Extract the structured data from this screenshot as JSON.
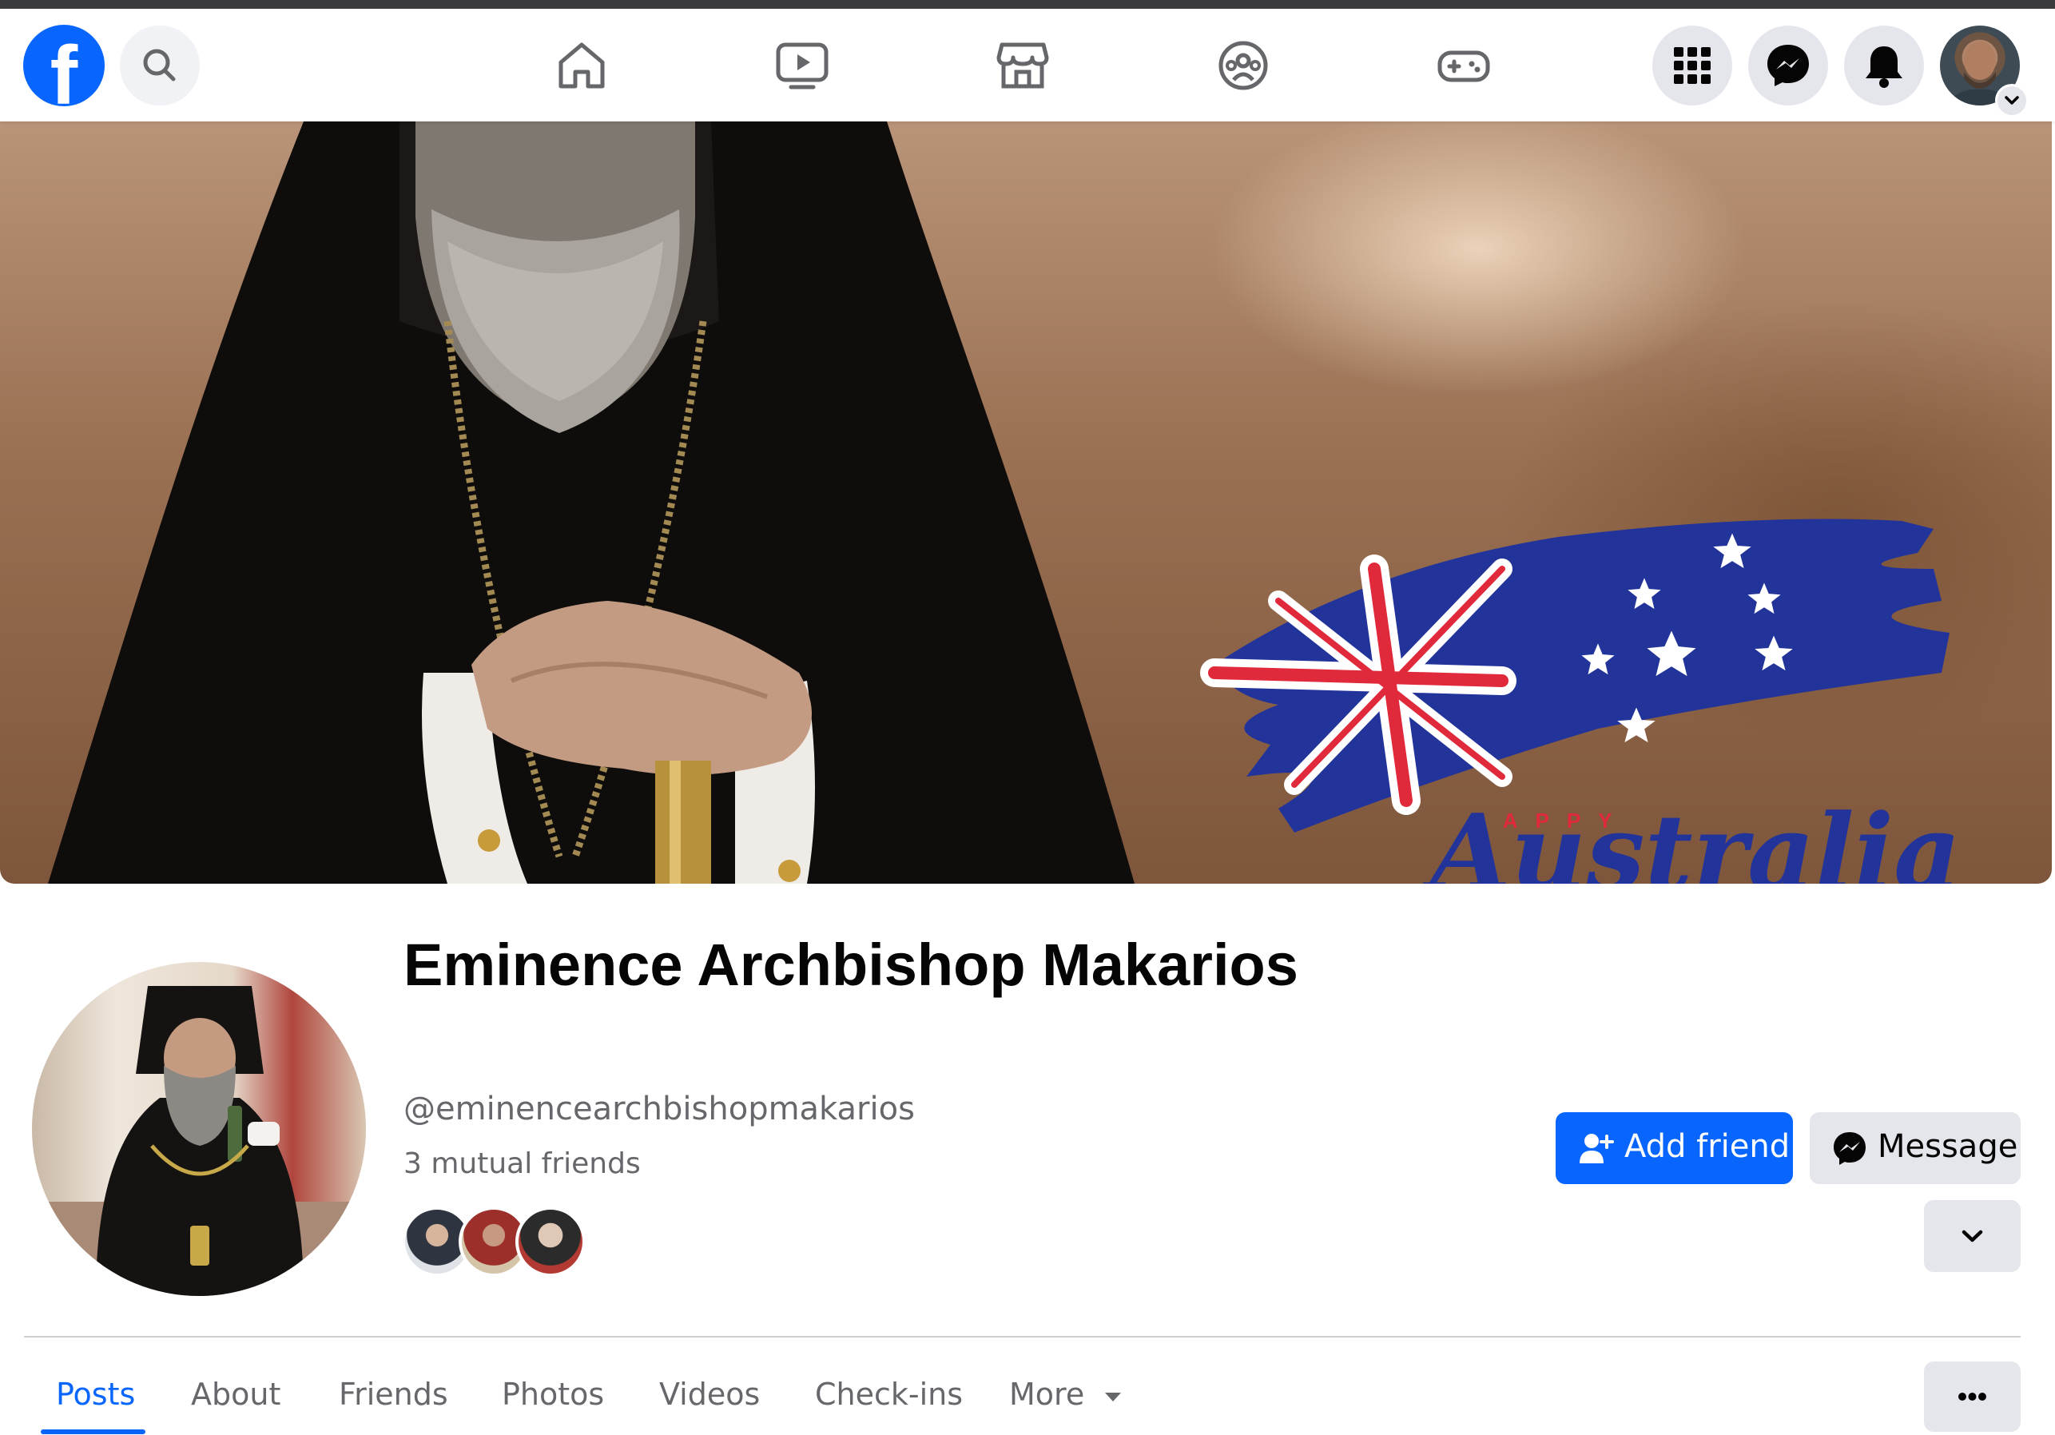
{
  "header": {
    "logo_letter": "f",
    "nav": [
      "home",
      "watch",
      "marketplace",
      "groups",
      "gaming"
    ]
  },
  "profile": {
    "name": "Eminence Archbishop Makarios",
    "handle": "@eminencearchbishopmakarios",
    "mutual_friends": "3 mutual friends",
    "cover_caption_small": "HAPPY",
    "cover_caption_large": "Australia"
  },
  "actions": {
    "add_friend": "Add friend",
    "message": "Message"
  },
  "tabs": [
    {
      "label": "Posts",
      "active": true
    },
    {
      "label": "About",
      "active": false
    },
    {
      "label": "Friends",
      "active": false
    },
    {
      "label": "Photos",
      "active": false
    },
    {
      "label": "Videos",
      "active": false
    },
    {
      "label": "Check-ins",
      "active": false
    },
    {
      "label": "More",
      "active": false
    }
  ],
  "colors": {
    "brand_blue": "#0866ff",
    "secondary_button": "#e4e6eb",
    "muted_text": "#65676b"
  }
}
